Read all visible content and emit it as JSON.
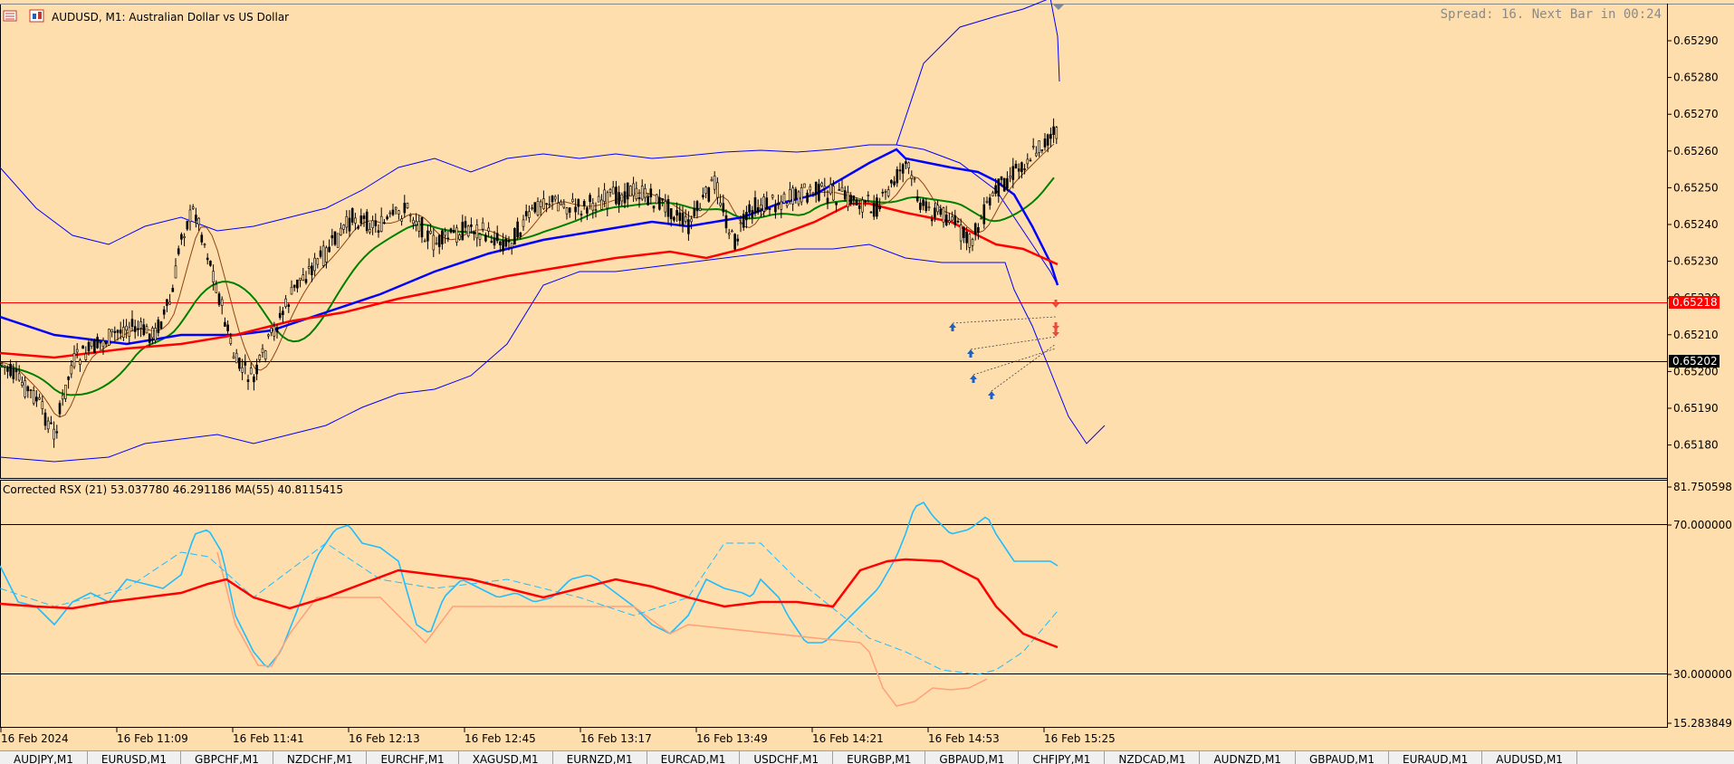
{
  "chart": {
    "symbol_line": "AUDUSD, M1:  Australian Dollar vs US Dollar",
    "info_text": "Spread: 16. Next Bar in 00:24",
    "price_ticks": [
      "0.65290",
      "0.65280",
      "0.65270",
      "0.65260",
      "0.65250",
      "0.65240",
      "0.65230",
      "0.65220",
      "0.65210",
      "0.65200",
      "0.65190",
      "0.65180"
    ],
    "price_labels": [
      {
        "label": "0.65218",
        "color": "#ff0000"
      },
      {
        "label": "0.65202",
        "color": "#000000"
      }
    ]
  },
  "indicator": {
    "title": "Corrected RSX (21) 53.037780 46.291186 MA(55) 40.8115415",
    "ticks": [
      "81.750598",
      "70.000000",
      "30.000000",
      "15.283849"
    ]
  },
  "time_ticks": [
    "16 Feb 2024",
    "16 Feb 11:09",
    "16 Feb 11:41",
    "16 Feb 12:13",
    "16 Feb 12:45",
    "16 Feb 13:17",
    "16 Feb 13:49",
    "16 Feb 14:21",
    "16 Feb 14:53",
    "16 Feb 15:25"
  ],
  "tabs": [
    "AUDJPY,M1",
    "EURUSD,M1",
    "GBPCHF,M1",
    "NZDCHF,M1",
    "EURCHF,M1",
    "XAGUSD,M1",
    "EURNZD,M1",
    "EURCAD,M1",
    "USDCHF,M1",
    "EURGBP,M1",
    "GBPAUD,M1",
    "CHFJPY,M1",
    "NZDCAD,M1",
    "AUDNZD,M1",
    "GBPAUD,M1",
    "EURAUD,M1",
    "AUDUSD,M1"
  ],
  "colors": {
    "background": "#ffdead",
    "candle": "#000000",
    "ma_fast": "#8b4513",
    "ma_green": "#008000",
    "ma_blue": "#0000ff",
    "ma_red": "#ff0000",
    "bands": "#0000ff",
    "rsx": "#1ebeff",
    "rsx_down": "#ffa07a",
    "rsx_ma": "#ff0000"
  },
  "icons": [
    "window-menu-icon",
    "chart-type-icon",
    "collapse-arrow-icon",
    "buy-arrow-icon",
    "sell-arrow-icon"
  ]
}
